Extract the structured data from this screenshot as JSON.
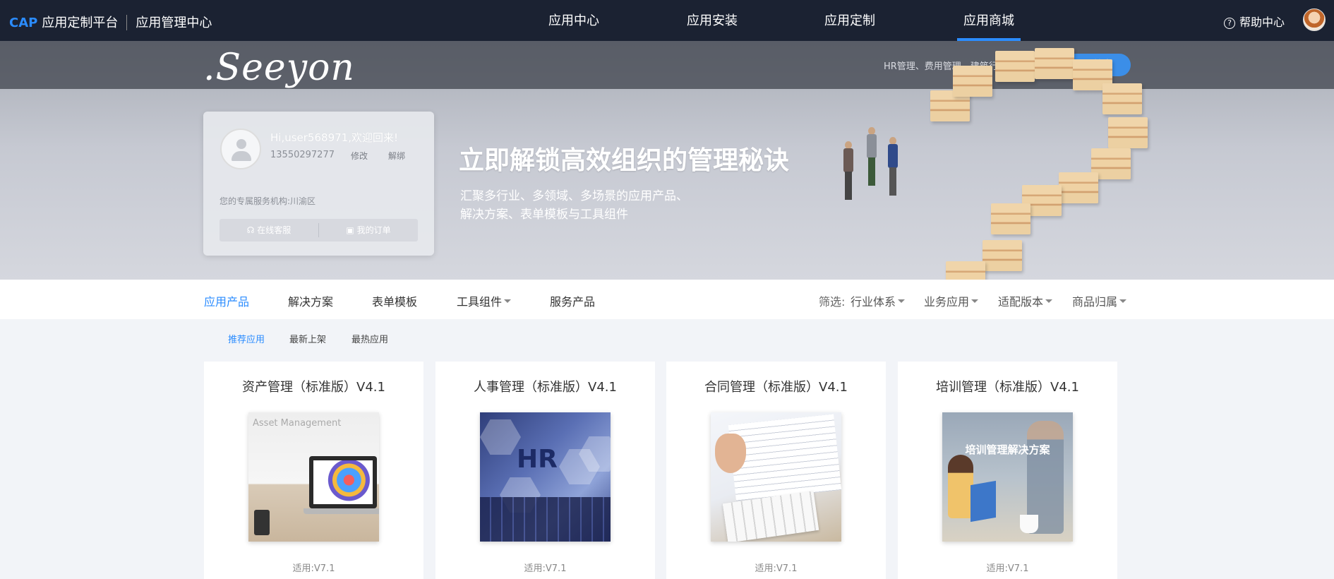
{
  "topbar": {
    "brand_cap": "CAP",
    "brand_name": "应用定制平台",
    "brand_section": "应用管理中心",
    "nav": [
      {
        "label": "应用中心",
        "active": false
      },
      {
        "label": "应用安装",
        "active": false
      },
      {
        "label": "应用定制",
        "active": false
      },
      {
        "label": "应用商城",
        "active": true
      }
    ],
    "help_icon": "question-circle-icon",
    "help_label": "帮助中心",
    "accent_color": "#2b8cff"
  },
  "hero": {
    "logo_text": ".Seeyon",
    "search_hint": "HR管理、费用管理、建筑行业",
    "search_button": "搜索",
    "user": {
      "greeting": "Hi,user568971,欢迎回来!",
      "phone": "13550297277",
      "edit": "修改",
      "unbind": "解绑",
      "org": "您的专属服务机构:川渝区",
      "online_service": "在线客服",
      "my_orders": "我的订单"
    },
    "slogan": "立即解锁高效组织的管理秘诀",
    "slogan_sub1": "汇聚多行业、多领域、多场景的应用产品、",
    "slogan_sub2": "解决方案、表单模板与工具组件"
  },
  "categories": {
    "tabs": [
      {
        "label": "应用产品",
        "active": true
      },
      {
        "label": "解决方案",
        "active": false
      },
      {
        "label": "表单模板",
        "active": false
      },
      {
        "label": "工具组件",
        "active": false,
        "dropdown": true
      },
      {
        "label": "服务产品",
        "active": false
      }
    ],
    "filter_label": "筛选:",
    "filters": [
      "行业体系",
      "业务应用",
      "适配版本",
      "商品归属"
    ]
  },
  "subtabs": [
    {
      "label": "推荐应用",
      "active": true
    },
    {
      "label": "最新上架",
      "active": false
    },
    {
      "label": "最热应用",
      "active": false
    }
  ],
  "products": [
    {
      "title": "资产管理（标准版）V4.1",
      "image_label": "Asset Management",
      "version": "适用:V7.1"
    },
    {
      "title": "人事管理（标准版）V4.1",
      "image_label": "HR",
      "version": "适用:V7.1"
    },
    {
      "title": "合同管理（标准版）V4.1",
      "image_label": "",
      "version": "适用:V7.1"
    },
    {
      "title": "培训管理（标准版）V4.1",
      "image_label": "培训管理解决方案",
      "version": "适用:V7.1"
    }
  ]
}
